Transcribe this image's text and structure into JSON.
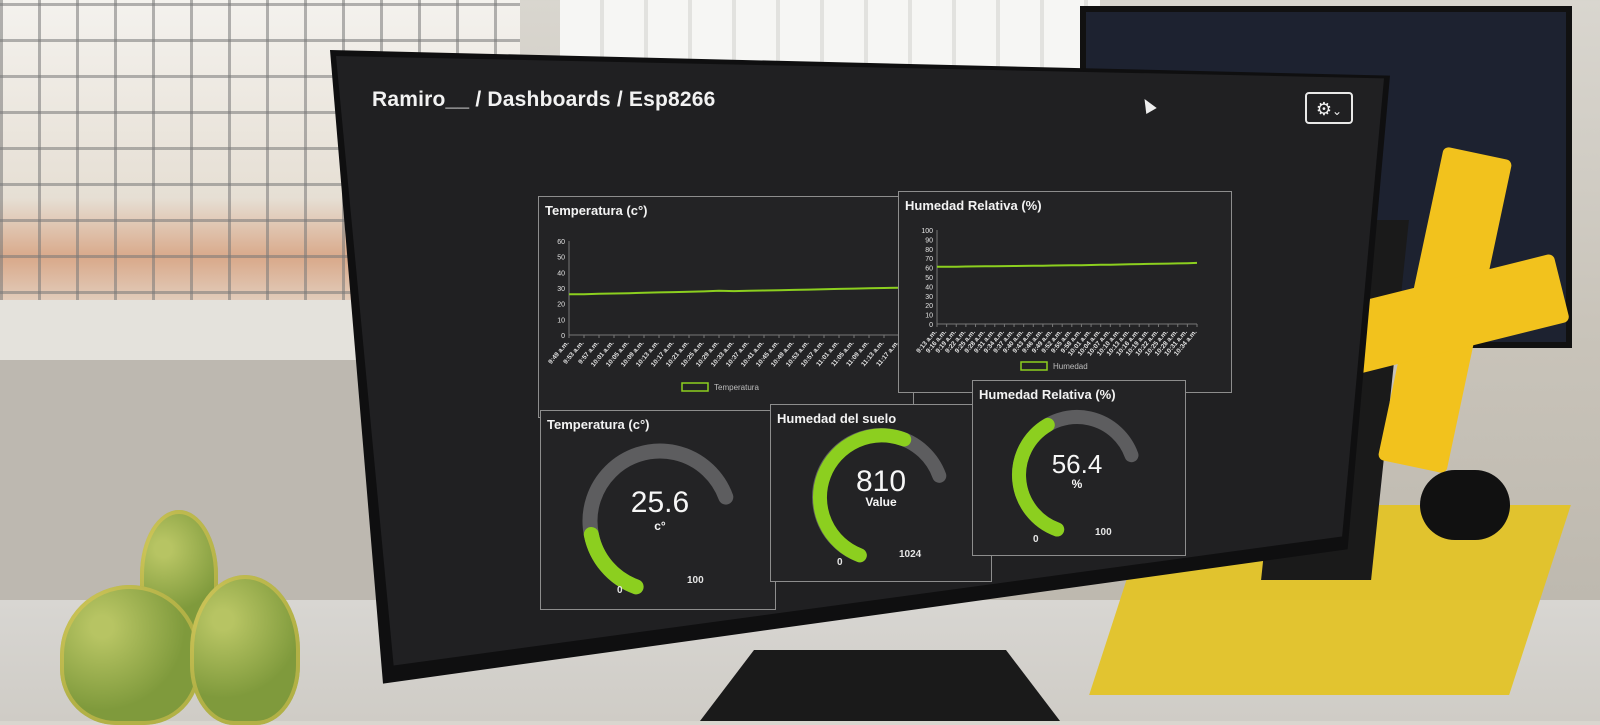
{
  "breadcrumb": "Ramiro__ / Dashboards / Esp8266",
  "settings_icon": "gear-icon",
  "colors": {
    "accent": "#8ccf1f",
    "track": "#5d5d5f",
    "panel_bg": "#232325",
    "screen_bg": "#202022"
  },
  "panels": {
    "temp_chart": {
      "title": "Temperatura (c°)"
    },
    "hum_chart": {
      "title": "Humedad Relativa (%)"
    },
    "temp_gauge": {
      "title": "Temperatura (c°)",
      "value": "25.6",
      "unit": "c°",
      "min": "0",
      "max": "100",
      "fraction": 0.256
    },
    "soil_gauge": {
      "title": "Humedad del suelo",
      "value": "810",
      "unit": "Value",
      "min": "0",
      "max": "1024",
      "fraction": 0.791
    },
    "hum_gauge": {
      "title": "Humedad Relativa (%)",
      "value": "56.4",
      "unit": "%",
      "min": "0",
      "max": "100",
      "fraction": 0.564
    }
  },
  "chart_data": [
    {
      "type": "line",
      "title": "Temperatura (c°)",
      "ylim": [
        0,
        60
      ],
      "yticks": [
        "0",
        "10",
        "20",
        "30",
        "40",
        "50",
        "60"
      ],
      "x": [
        "9:49 a.m.",
        "9:53 a.m.",
        "9:57 a.m.",
        "10:01 a.m.",
        "10:05 a.m.",
        "10:09 a.m.",
        "10:13 a.m.",
        "10:17 a.m.",
        "10:21 a.m.",
        "10:25 a.m.",
        "10:29 a.m.",
        "10:33 a.m.",
        "10:37 a.m.",
        "10:41 a.m.",
        "10:45 a.m.",
        "10:49 a.m.",
        "10:53 a.m.",
        "10:57 a.m.",
        "11:01 a.m.",
        "11:05 a.m.",
        "11:09 a.m.",
        "11:13 a.m.",
        "11:17 a.m."
      ],
      "series": [
        {
          "name": "Temperatura",
          "values": [
            26,
            26,
            26.3,
            26.5,
            26.7,
            27,
            27.2,
            27.4,
            27.6,
            27.8,
            28.2,
            28,
            28.2,
            28.4,
            28.6,
            28.8,
            29,
            29.2,
            29.4,
            29.6,
            29.8,
            30,
            30.2
          ]
        }
      ],
      "grid": false,
      "legend": "bottom"
    },
    {
      "type": "line",
      "title": "Humedad Relativa (%)",
      "ylim": [
        0,
        100
      ],
      "yticks": [
        "0",
        "10",
        "20",
        "30",
        "40",
        "50",
        "60",
        "70",
        "80",
        "90",
        "100"
      ],
      "x": [
        "9:13 a.m.",
        "9:16 a.m.",
        "9:19 a.m.",
        "9:22 a.m.",
        "9:25 a.m.",
        "9:28 a.m.",
        "9:31 a.m.",
        "9:34 a.m.",
        "9:37 a.m.",
        "9:40 a.m.",
        "9:43 a.m.",
        "9:46 a.m.",
        "9:49 a.m.",
        "9:52 a.m.",
        "9:55 a.m.",
        "9:58 a.m.",
        "10:01 a.m.",
        "10:04 a.m.",
        "10:07 a.m.",
        "10:10 a.m.",
        "10:13 a.m.",
        "10:16 a.m.",
        "10:19 a.m.",
        "10:22 a.m.",
        "10:25 a.m.",
        "10:28 a.m.",
        "10:31 a.m.",
        "10:34 a.m."
      ],
      "series": [
        {
          "name": "Humedad",
          "values": [
            61,
            61,
            61,
            61.2,
            61.3,
            61.4,
            61.5,
            61.6,
            61.7,
            61.8,
            62,
            62,
            62.2,
            62.3,
            62.5,
            62.6,
            62.8,
            63,
            63.1,
            63.3,
            63.5,
            63.7,
            63.9,
            64.1,
            64.3,
            64.5,
            64.7,
            65
          ]
        }
      ],
      "grid": false,
      "legend": "bottom"
    }
  ]
}
